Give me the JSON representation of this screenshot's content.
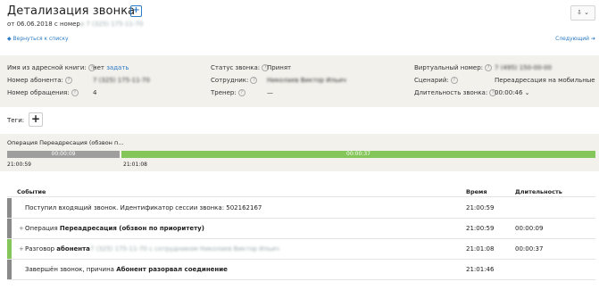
{
  "header": {
    "title": "Детализация звонка",
    "add_symbol": "+",
    "subtitle_prefix": "от 06.06.2018 с номер",
    "subtitle_masked": "а 7 (325) 175-11-70",
    "export_label": "⇩ ⌄",
    "back_link": "◆ Вернуться к списку",
    "next_link": "Следующий ➔"
  },
  "info": {
    "col1": [
      {
        "label": "Имя из адресной книги:",
        "value": "нет",
        "link": "задать"
      },
      {
        "label": "Номер абонента:",
        "value": "7 (325) 175-11-70",
        "masked": true
      },
      {
        "label": "Номер обращения:",
        "value": "4",
        "link_value": true
      }
    ],
    "col2": [
      {
        "label": "Статус звонка:",
        "value": "Принят"
      },
      {
        "label": "Сотрудник:",
        "value": "Николаев Виктор Ильич",
        "masked": true
      },
      {
        "label": "Тренер:",
        "value": "—"
      }
    ],
    "col3": [
      {
        "label": "Виртуальный номер:",
        "value": "7 (495) 150-00-00",
        "masked": true
      },
      {
        "label": "Сценарий:",
        "value": "Переадресация на мобильные"
      },
      {
        "label": "Длительность звонка:",
        "value": "00:00:46 ⌄"
      }
    ]
  },
  "tags": {
    "label": "Теги:",
    "add": "+"
  },
  "timeline": {
    "operation_label": "Операция Переадресация (обзвон п...",
    "segments": [
      {
        "duration": "00:00:09",
        "start": "21:00:59",
        "color": "#9e9e9e",
        "share": 0.196
      },
      {
        "duration": "00:00:37",
        "start": "21:01:08",
        "color": "#84c65a",
        "share": 0.804
      }
    ]
  },
  "events": {
    "headers": {
      "event": "Событие",
      "time": "Время",
      "duration": "Длительность"
    },
    "rows": [
      {
        "mark": "#8a8a8a",
        "expand": "",
        "text_plain": "Поступил входящий звонок. Идентификатор сессии звонка: 502162167",
        "text_bold": "",
        "text_tail": "",
        "time": "21:00:59",
        "duration": ""
      },
      {
        "mark": "#8a8a8a",
        "expand": "+",
        "text_plain": "Операция ",
        "text_bold": "Переадресация (обзвон по приоритету)",
        "text_tail": "",
        "time": "21:00:59",
        "duration": "00:00:09"
      },
      {
        "mark": "#84c65a",
        "expand": "+",
        "text_plain": "Разговор ",
        "text_bold": "абонента",
        "text_tail": " 7 (325) 175-11-70 с сотрудником Николаев Виктор Ильич",
        "time": "21:01:08",
        "duration": "00:00:37"
      },
      {
        "mark": "#8a8a8a",
        "expand": "",
        "text_plain": "Завершён звонок, причина ",
        "text_bold": "Абонент разорвал соединение",
        "text_tail": "",
        "time": "21:01:46",
        "duration": ""
      }
    ]
  }
}
